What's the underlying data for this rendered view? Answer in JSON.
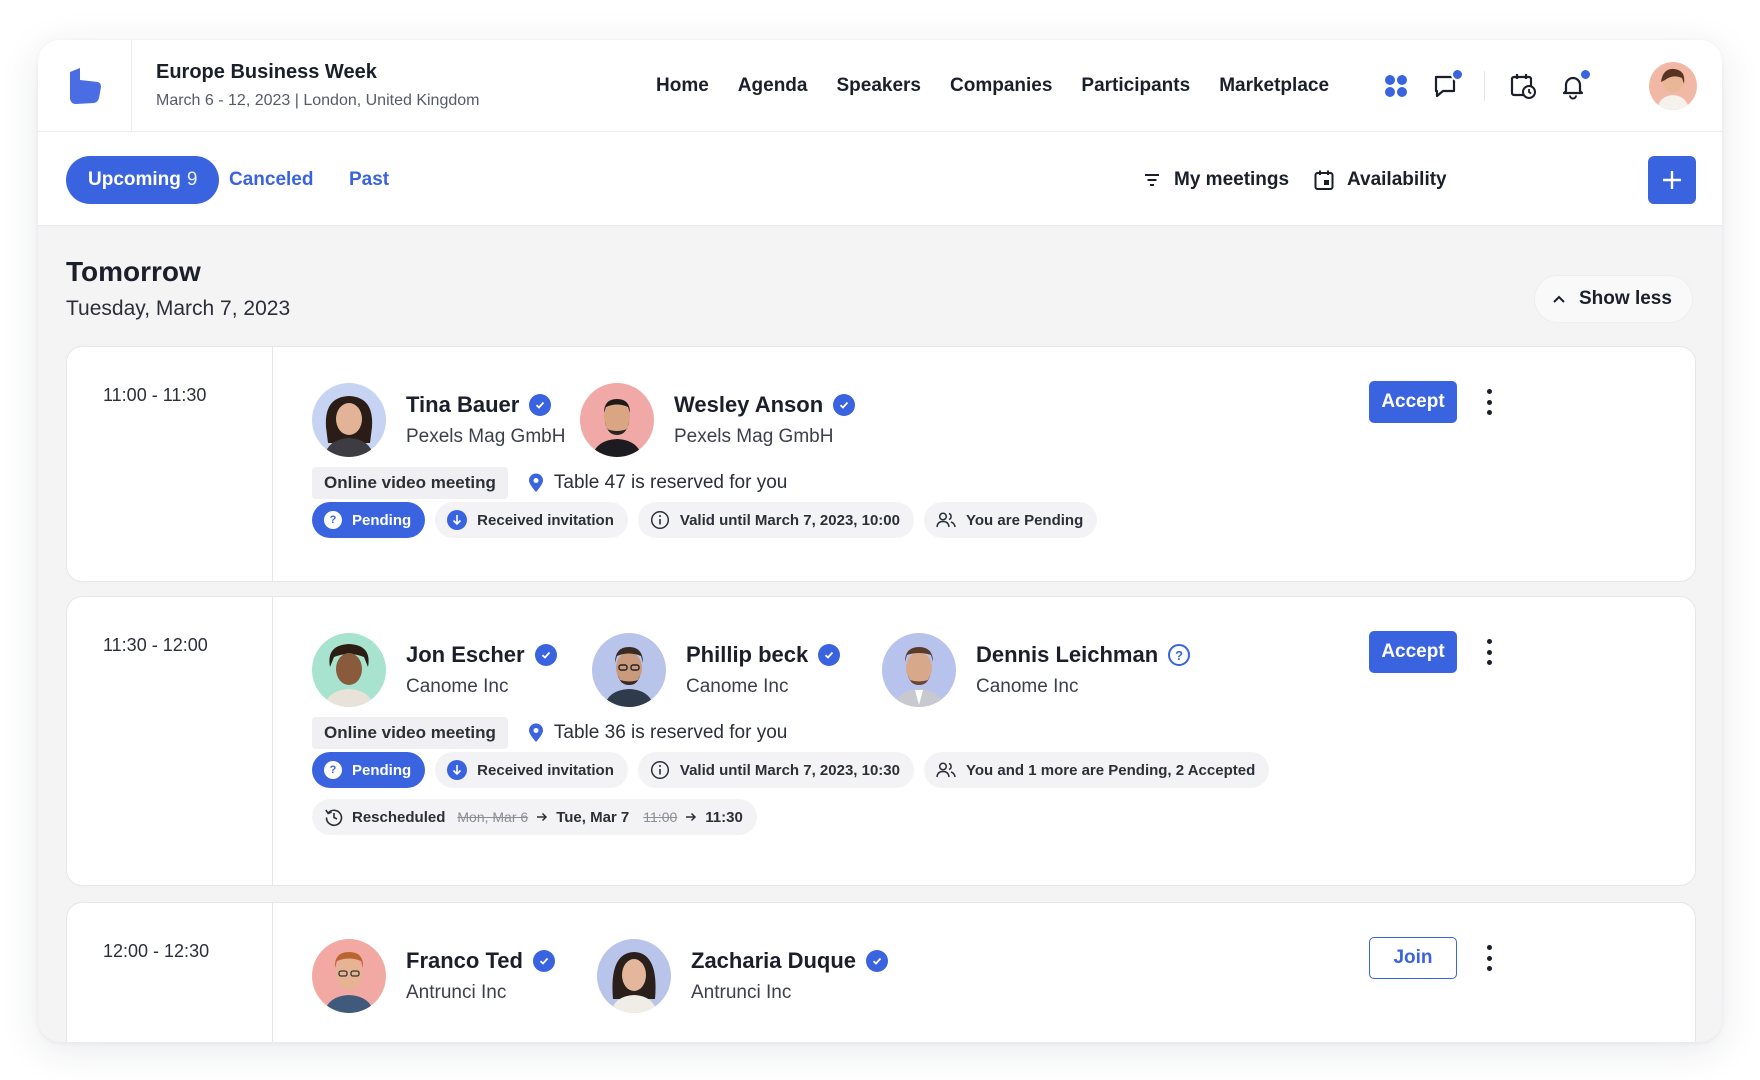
{
  "event": {
    "title": "Europe Business Week",
    "subtitle": "March 6 - 12, 2023 | London, United Kingdom"
  },
  "nav": [
    "Home",
    "Agenda",
    "Speakers",
    "Companies",
    "Participants",
    "Marketplace"
  ],
  "tabs": {
    "upcoming_label": "Upcoming",
    "upcoming_count": "9",
    "canceled": "Canceled",
    "past": "Past"
  },
  "tools": {
    "my_meetings": "My meetings",
    "availability": "Availability"
  },
  "day": {
    "title": "Tomorrow",
    "date": "Tuesday, March 7, 2023",
    "show_less": "Show less"
  },
  "meetings": [
    {
      "time": "11:00 - 11:30",
      "people": [
        {
          "name": "Tina Bauer",
          "company": "Pexels Mag GmbH",
          "verified": true
        },
        {
          "name": "Wesley Anson",
          "company": "Pexels Mag GmbH",
          "verified": true
        }
      ],
      "meeting_type": "Online video meeting",
      "table": "Table 47 is reserved for you",
      "status": "Pending",
      "direction": "Received invitation",
      "valid_until": "Valid until March 7, 2023, 10:00",
      "attendance": "You are Pending",
      "action": "Accept"
    },
    {
      "time": "11:30 - 12:00",
      "people": [
        {
          "name": "Jon Escher",
          "company": "Canome Inc",
          "verified": true
        },
        {
          "name": "Phillip beck",
          "company": "Canome Inc",
          "verified": true
        },
        {
          "name": "Dennis Leichman",
          "company": "Canome Inc",
          "verified": false
        }
      ],
      "meeting_type": "Online video meeting",
      "table": "Table 36 is reserved for you",
      "status": "Pending",
      "direction": "Received invitation",
      "valid_until": "Valid until March 7, 2023, 10:30",
      "attendance": "You and 1 more are Pending, 2 Accepted",
      "rescheduled": {
        "label": "Rescheduled",
        "old_date": "Mon, Mar 6",
        "new_date": "Tue, Mar 7",
        "old_time": "11:00",
        "new_time": "11:30"
      },
      "action": "Accept"
    },
    {
      "time": "12:00 - 12:30",
      "people": [
        {
          "name": "Franco Ted",
          "company": "Antrunci Inc",
          "verified": true
        },
        {
          "name": "Zacharia Duque",
          "company": "Antrunci Inc",
          "verified": true
        }
      ],
      "action": "Join"
    }
  ],
  "colors": {
    "accent": "#3a63e0",
    "text": "#1b1f2a",
    "page_bg": "#f4f4f5"
  }
}
